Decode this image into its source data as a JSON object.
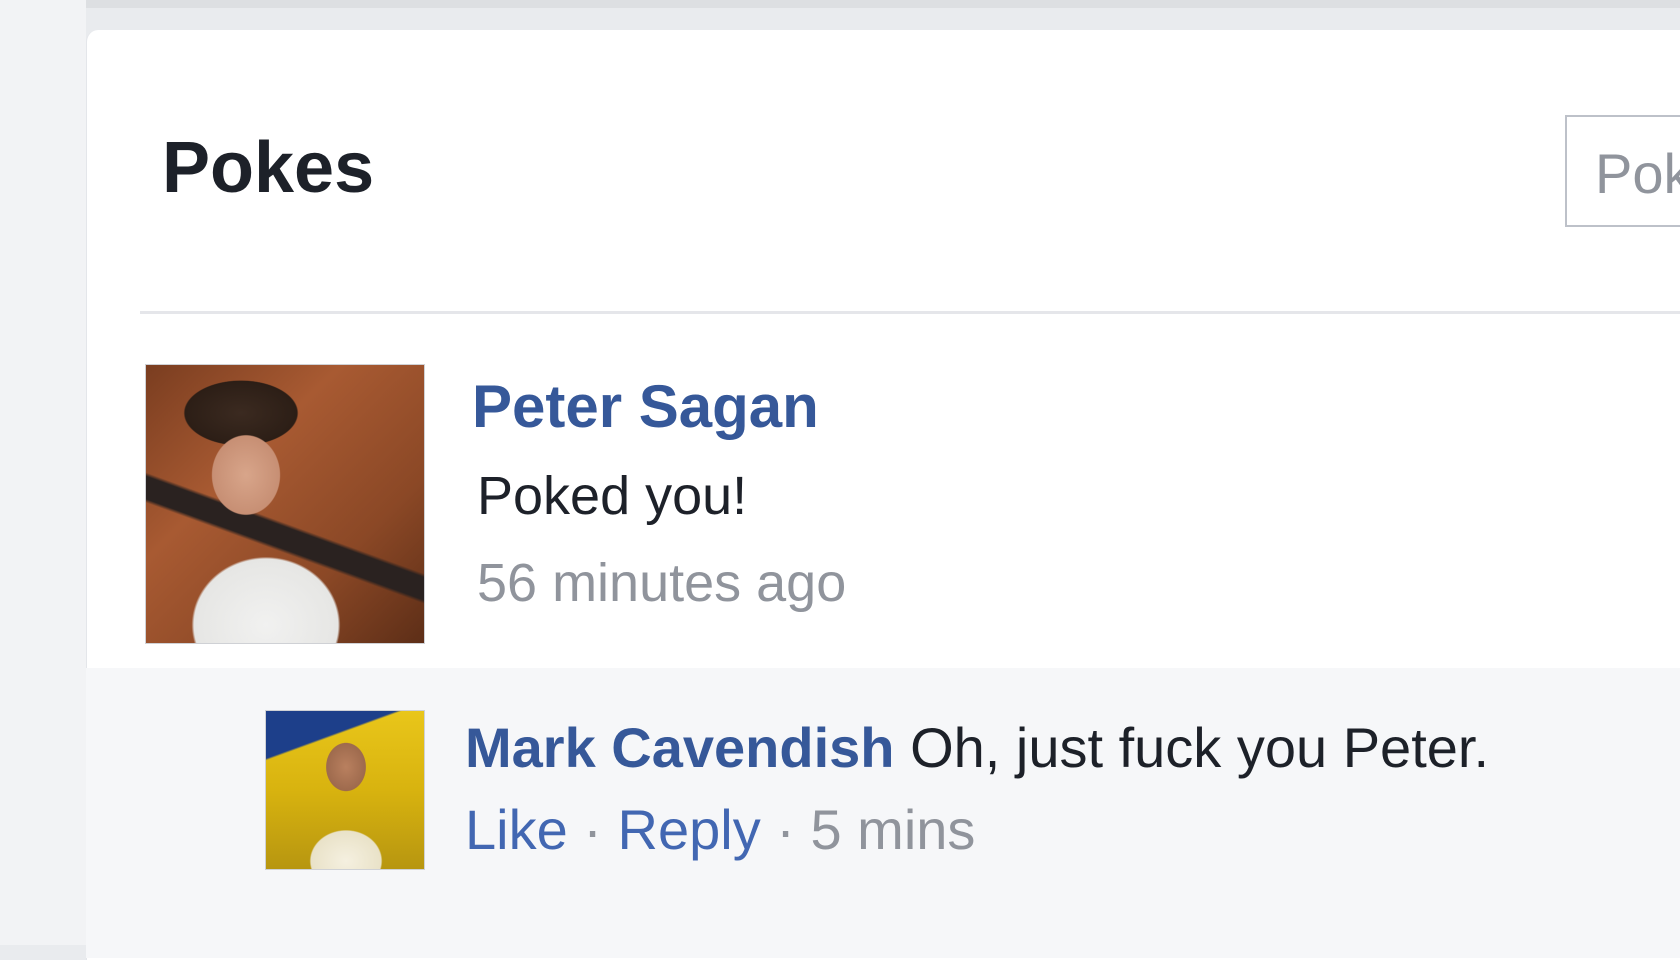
{
  "page": {
    "title": "Pokes",
    "search_placeholder": "Pokes"
  },
  "poke": {
    "name": "Peter Sagan",
    "message": "Poked you!",
    "time": "56 minutes ago",
    "avatar_icon": "profile-photo"
  },
  "comment": {
    "author": "Mark Cavendish",
    "text": "Oh, just fuck you Peter.",
    "like_label": "Like",
    "separator": "·",
    "reply_label": "Reply",
    "time": "5 mins",
    "avatar_icon": "profile-photo"
  },
  "colors": {
    "link": "#365899",
    "text": "#1d2129",
    "muted": "#90949c",
    "background": "#e9ebee"
  }
}
